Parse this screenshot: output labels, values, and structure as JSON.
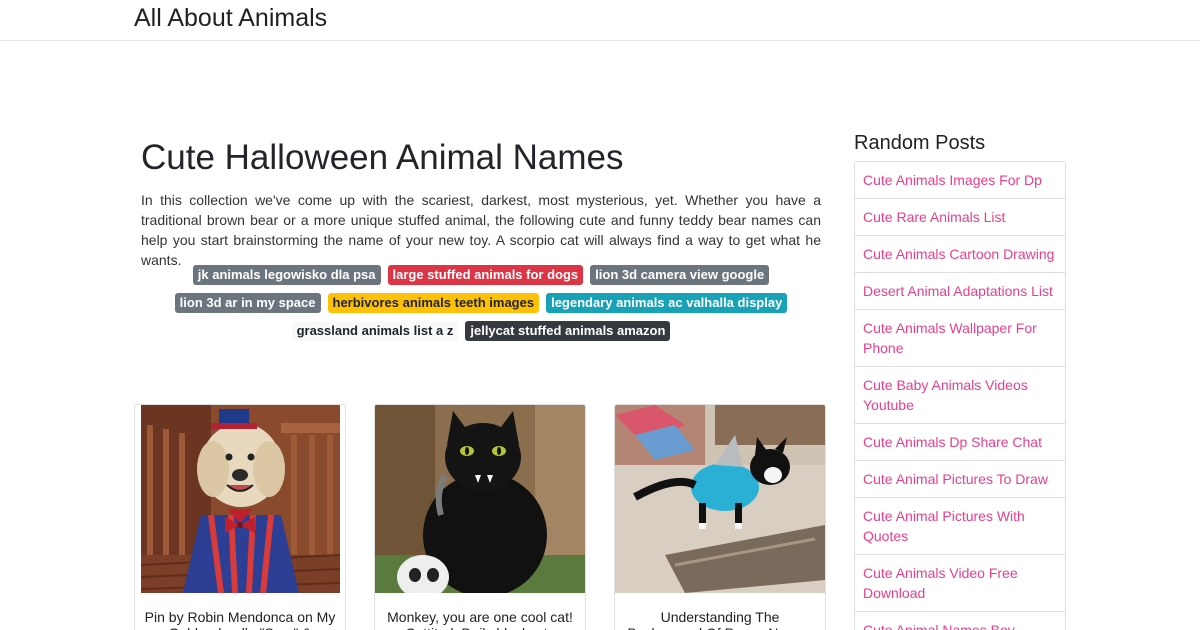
{
  "site": {
    "brand": "All About Animals"
  },
  "article": {
    "title": "Cute Halloween Animal Names",
    "intro": "In this collection we've come up with the scariest, darkest, most mysterious, yet. Whether you have a traditional brown bear or a more unique stuffed animal, the following cute and funny teddy bear names can help you start brainstorming the name of your new toy. A scorpio cat will always find a way to get what he wants."
  },
  "tags": [
    {
      "label": "jk animals legowisko dla psa",
      "color": "#6c757d"
    },
    {
      "label": "large stuffed animals for dogs",
      "color": "#dc3545"
    },
    {
      "label": "lion 3d camera view google",
      "color": "#6c757d"
    },
    {
      "label": "lion 3d ar in my space",
      "color": "#6c757d"
    },
    {
      "label": "herbivores animals teeth images",
      "color": "#ffc107"
    },
    {
      "label": "legendary animals ac valhalla display",
      "color": "#17a2b8"
    },
    {
      "label": "grassland animals list a z",
      "color": "#f8f9fa"
    },
    {
      "label": "jellycat stuffed animals amazon",
      "color": "#343a40"
    }
  ],
  "cards": [
    {
      "caption": "Pin by Robin Mendonca on My Goldendoodle \"Sam\" &",
      "image": "dog in patriotic costume"
    },
    {
      "caption": "Monkey, you are one cool cat! CattitudeDaily blackcats",
      "image": "black cat with fangs"
    },
    {
      "caption": "Understanding The Background Of Punny Names",
      "image": "cat in shark costume"
    }
  ],
  "sidebar": {
    "title": "Random Posts",
    "items": [
      "Cute Animals Images For Dp",
      "Cute Rare Animals List",
      "Cute Animals Cartoon Drawing",
      "Desert Animal Adaptations List",
      "Cute Animals Wallpaper For Phone",
      "Cute Baby Animals Videos Youtube",
      "Cute Animals Dp Share Chat",
      "Cute Animal Pictures To Draw",
      "Cute Animal Pictures With Quotes",
      "Cute Animals Video Free Download",
      "Cute Animal Names Boy"
    ],
    "link_color": "#e83e8c"
  }
}
